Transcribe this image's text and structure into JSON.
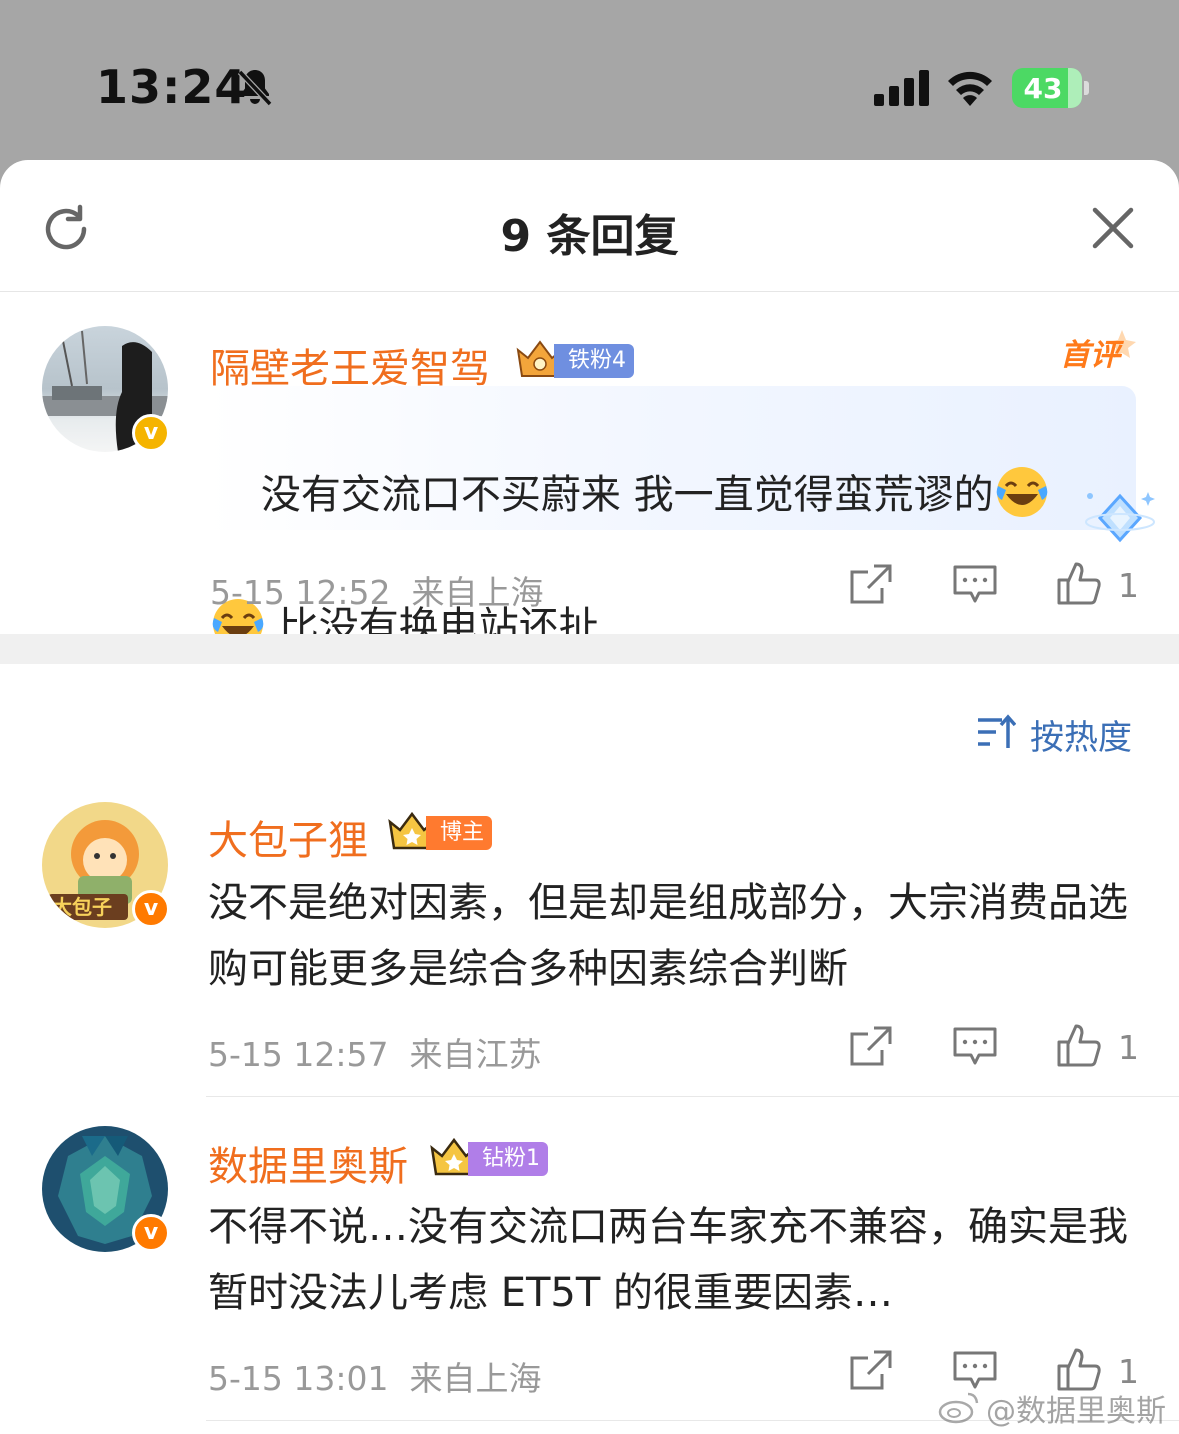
{
  "status_bar": {
    "time": "13:24",
    "battery": "43",
    "icons": [
      "bell-slash-icon",
      "cellular-signal-icon",
      "wifi-icon",
      "battery-charging-icon"
    ]
  },
  "sheet": {
    "title": "9 条回复",
    "refresh_icon": "refresh-icon",
    "close_icon": "close-icon"
  },
  "main_comment": {
    "username": "隔壁老王爱智驾",
    "fan_badge": "铁粉4",
    "first_tag": "首评",
    "text_part1": "没有交流口不买蔚来 我一直觉得蛮荒谬的",
    "text_part2": "比没有换电站还扯",
    "emoji": "laugh-cry-emoji",
    "date": "5-15 12:52",
    "location": "来自上海",
    "likes": "1"
  },
  "sort": {
    "label": "按热度"
  },
  "replies": [
    {
      "username": "大包子狸",
      "badge": "博主",
      "badge_color": "#ff7a2f",
      "text": "没不是绝对因素，但是却是组成部分，大宗消费品选购可能更多是综合多种因素综合判断",
      "date": "5-15 12:57",
      "location": "来自江苏",
      "likes": "1"
    },
    {
      "username": "数据里奥斯",
      "badge": "钻粉1",
      "badge_color": "#b07ee8",
      "text": "不得不说…没有交流口两台车家充不兼容，确实是我暂时没法儿考虑 ET5T 的很重要因素…",
      "date": "5-15 13:01",
      "location": "来自上海",
      "likes": "1"
    }
  ],
  "watermark": "@数据里奥斯",
  "colors": {
    "username": "#f06e1e",
    "meta": "#999999",
    "sort": "#3b6fb6",
    "status_bg": "#a6a6a6",
    "battery": "#4cd964"
  }
}
